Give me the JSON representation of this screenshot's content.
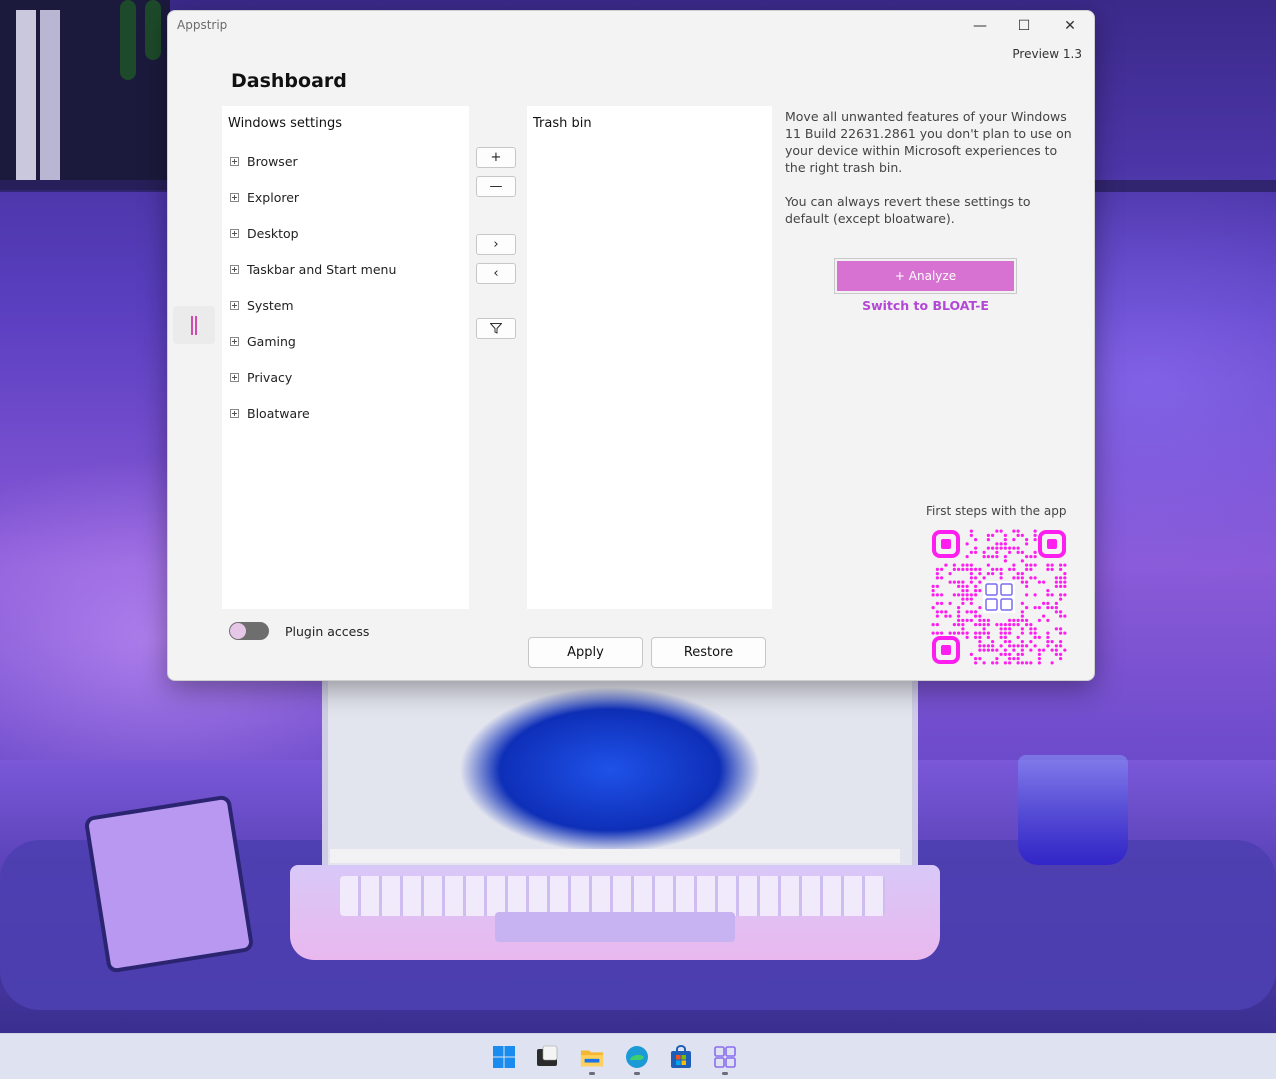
{
  "window": {
    "title": "Appstrip",
    "version": "Preview 1.3",
    "controls": {
      "minimize": "—",
      "maximize": "☐",
      "close": "✕"
    }
  },
  "page": {
    "title": "Dashboard"
  },
  "left_panel": {
    "header": "Windows settings",
    "items": [
      {
        "label": "Browser"
      },
      {
        "label": "Explorer"
      },
      {
        "label": "Desktop"
      },
      {
        "label": "Taskbar and Start menu"
      },
      {
        "label": "System"
      },
      {
        "label": "Gaming"
      },
      {
        "label": "Privacy"
      },
      {
        "label": "Bloatware"
      }
    ]
  },
  "middle_buttons": {
    "add": "+",
    "remove": "—",
    "move_right": "›",
    "move_left": "‹",
    "filter": "filter-icon"
  },
  "trash_panel": {
    "header": "Trash bin"
  },
  "info": {
    "description": "Move all unwanted features of your Windows 11 Build 22631.2861 you don't plan to use on your device within Microsoft experiences to the right trash bin.",
    "note": "You can always revert these settings to default (except bloatware).",
    "analyze_label": "+ Analyze",
    "switch_label": "Switch to BLOAT-E",
    "qr_title": "First steps with the app"
  },
  "plugin_toggle": {
    "label": "Plugin access",
    "checked": false
  },
  "actions": {
    "apply": "Apply",
    "restore": "Restore"
  },
  "colors": {
    "accent": "#d872d2",
    "link": "#b448d6",
    "qr": "#ff1ef0"
  },
  "taskbar": {
    "icons": [
      "windows-start-icon",
      "terminal-icon",
      "file-explorer-icon",
      "edge-icon",
      "store-icon",
      "appstrip-icon"
    ]
  }
}
